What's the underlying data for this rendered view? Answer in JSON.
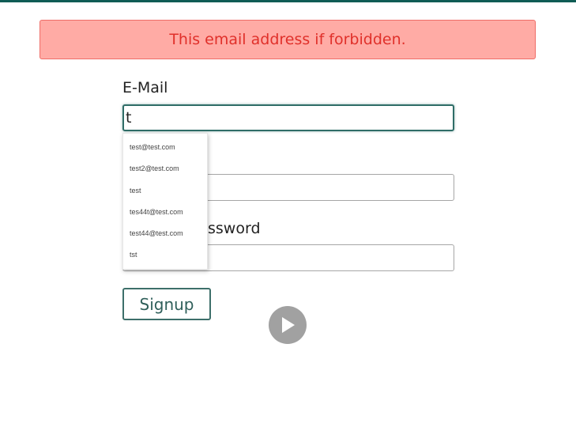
{
  "alert": {
    "message": "This email address if forbidden."
  },
  "form": {
    "email_label": "E-Mail",
    "email_value": "t",
    "password_value": "",
    "password_confirm_label_visible": "ssword",
    "password_confirm_value": "",
    "signup_label": "Signup"
  },
  "autocomplete": {
    "items": [
      "test@test.com",
      "test2@test.com",
      "test",
      "tes44t@test.com",
      "test44@test.com",
      "tst"
    ]
  },
  "colors": {
    "top_bar": "#0f5c55",
    "alert_bg": "#ffaba5",
    "alert_text": "#e0302a",
    "accent": "#2f6d67"
  },
  "icons": {
    "video_overlay": "play-icon"
  }
}
